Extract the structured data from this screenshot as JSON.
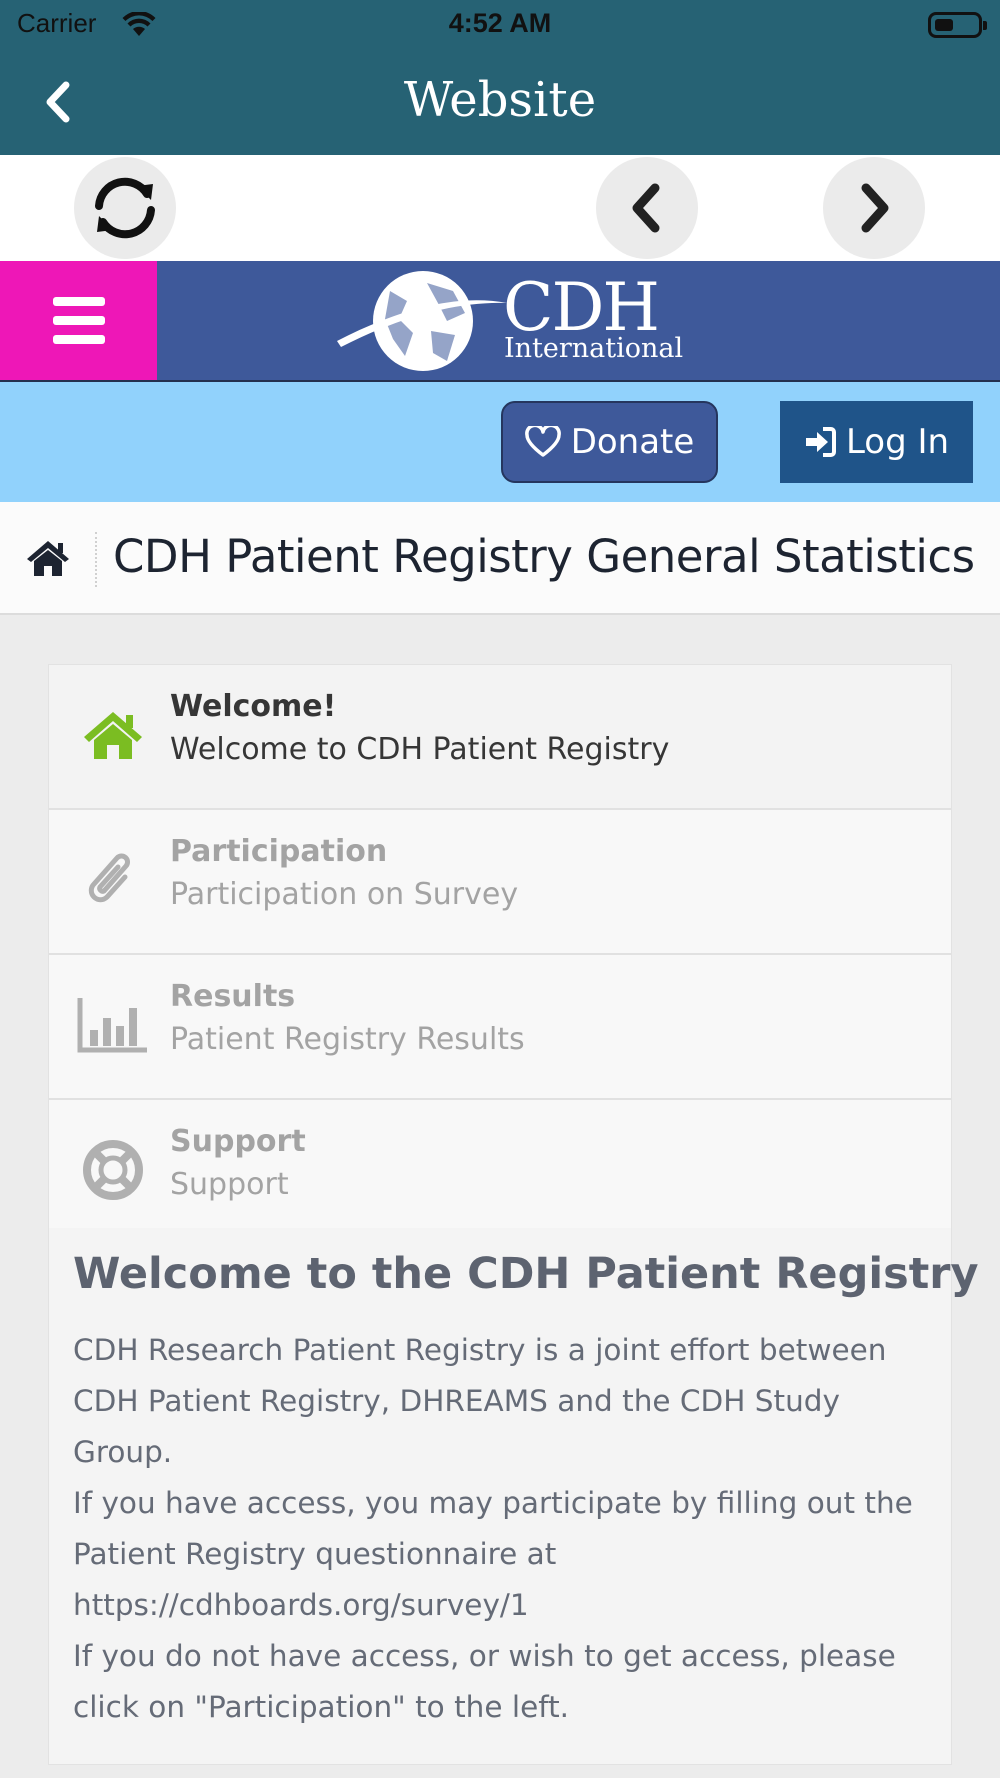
{
  "status_bar": {
    "carrier": "Carrier",
    "time": "4:52 AM"
  },
  "nav": {
    "title": "Website"
  },
  "site_header": {
    "logo_line1": "CDH",
    "logo_line2": "International"
  },
  "actions": {
    "donate_label": "Donate",
    "login_label": "Log In"
  },
  "breadcrumb": {
    "title": "CDH Patient Registry General Statistics"
  },
  "menu_items": [
    {
      "title": "Welcome!",
      "subtitle": "Welcome to CDH Patient Registry",
      "icon": "home-icon",
      "active": true
    },
    {
      "title": "Participation",
      "subtitle": "Participation on Survey",
      "icon": "paperclip-icon",
      "active": false
    },
    {
      "title": "Results",
      "subtitle": "Patient Registry Results",
      "icon": "bar-chart-icon",
      "active": false
    },
    {
      "title": "Support",
      "subtitle": "Support",
      "icon": "life-ring-icon",
      "active": false
    }
  ],
  "intro": {
    "heading": "Welcome to the CDH Patient Registry",
    "paragraph1": "CDH Research Patient Registry is a joint effort between CDH Patient Registry, DHREAMS and the CDH Study Group.",
    "paragraph2": "If you have access, you may participate by filling out the Patient Registry questionnaire at https://cdhboards.org/survey/1",
    "paragraph3": "If you do not have access, or wish to get access, please click on \"Participation\" to the left."
  },
  "colors": {
    "nav_bar": "#266274",
    "site_header": "#3e599a",
    "menu_button": "#ee17b7",
    "action_bar": "#91d2fc",
    "login_button": "#1f5489",
    "active_icon": "#7bbd22"
  }
}
